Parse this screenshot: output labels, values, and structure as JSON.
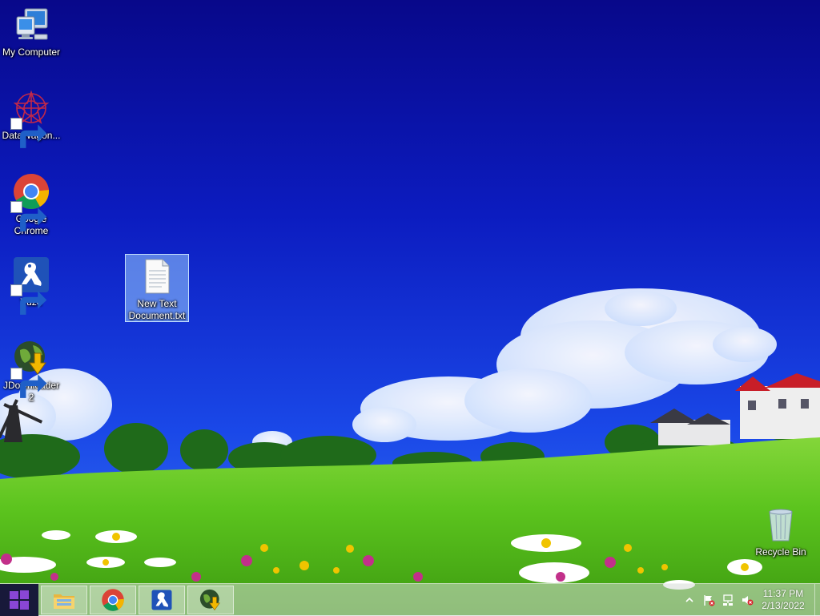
{
  "desktop": {
    "icons": [
      {
        "label": "My Computer",
        "icon": "computer-icon"
      },
      {
        "label": "DataWagon...",
        "icon": "datawagon-icon",
        "shortcut": true
      },
      {
        "label": "Google Chrome",
        "icon": "chrome-icon",
        "shortcut": true
      },
      {
        "label": "Vuze",
        "icon": "vuze-frog-icon",
        "shortcut": true
      },
      {
        "label": "JDownloader 2",
        "icon": "jdownloader-icon",
        "shortcut": true
      },
      {
        "label": "New Text Document.txt",
        "icon": "text-document-icon",
        "selected": true
      },
      {
        "label": "Recycle Bin",
        "icon": "recycle-bin-icon"
      }
    ]
  },
  "taskbar": {
    "pinned": [
      {
        "app": "File Explorer",
        "icon": "folder-icon"
      },
      {
        "app": "Google Chrome",
        "icon": "chrome-icon"
      },
      {
        "app": "Vuze",
        "icon": "vuze-frog-icon"
      },
      {
        "app": "JDownloader 2",
        "icon": "jdownloader-icon"
      }
    ],
    "tray": {
      "icons": [
        "chevron-up-icon",
        "action-center-flag-icon",
        "network-icon",
        "speaker-muted-icon"
      ],
      "clock": {
        "time": "11:37 PM",
        "date": "2/13/2022"
      }
    }
  },
  "colors": {
    "sky_top": "#0a0a9a",
    "sky_mid": "#1840e0",
    "grass": "#58c21c",
    "selection": "#99ccff",
    "start_button": "#18193a"
  }
}
